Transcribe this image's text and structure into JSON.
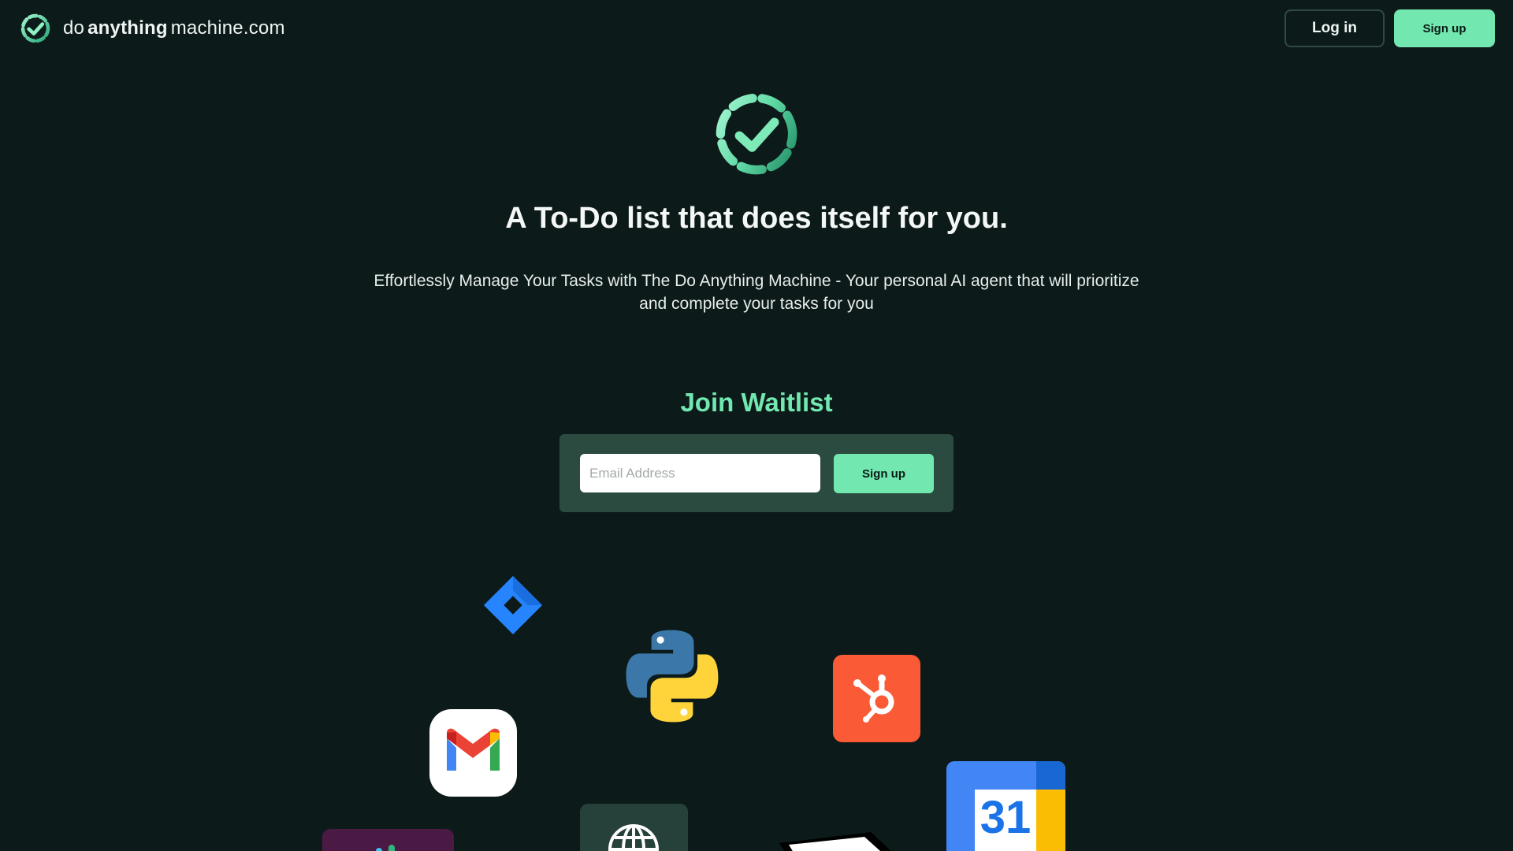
{
  "header": {
    "brand": {
      "word1": "do",
      "word2": "anything",
      "word3": "machine.com"
    },
    "login_label": "Log in",
    "signup_label": "Sign up"
  },
  "hero": {
    "title": "A To-Do list that does itself for you.",
    "subtitle": "Effortlessly Manage Your Tasks with The Do Anything Machine  - Your personal AI agent that will prioritize and complete your tasks for you"
  },
  "waitlist": {
    "title": "Join Waitlist",
    "email_placeholder": "Email Address",
    "signup_label": "Sign up"
  },
  "integrations": {
    "icons": [
      "jira-icon",
      "python-icon",
      "hubspot-icon",
      "gmail-icon",
      "google-calendar-icon",
      "globe-icon",
      "slack-icon",
      "notion-icon"
    ],
    "calendar_day": "31"
  },
  "colors": {
    "background": "#0d1a1a",
    "accent": "#72e8b0",
    "form_panel": "#2b4a40"
  }
}
